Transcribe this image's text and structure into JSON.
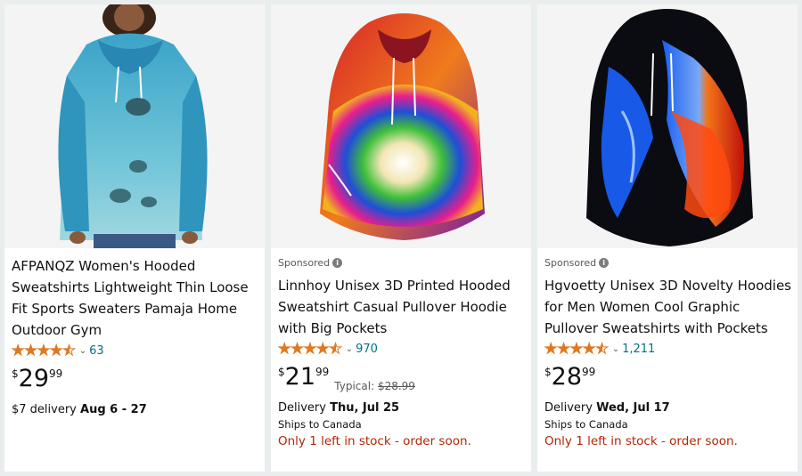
{
  "products": [
    {
      "sponsored": "",
      "title": "AFPANQZ Women's Hooded Sweatshirts Lightweight Thin Loose Fit Sports Sweaters Pamaja Home Outdoor Gym",
      "rating": 4.5,
      "review_count": "63",
      "price_symbol": "$",
      "price_whole": "29",
      "price_fraction": "99",
      "typical_label": "",
      "typical_price": "",
      "delivery_prefix": "$7 delivery ",
      "delivery_date": "Aug 6 - 27",
      "ships_to": "",
      "stock": "",
      "image_icon": "turtle-hoodie-image"
    },
    {
      "sponsored": "Sponsored",
      "title": "Linnhoy Unisex 3D Printed Hooded Sweatshirt Casual Pullover Hoodie with Big Pockets",
      "rating": 4.5,
      "review_count": "970",
      "price_symbol": "$",
      "price_whole": "21",
      "price_fraction": "99",
      "typical_label": "Typical: ",
      "typical_price": "$28.99",
      "delivery_prefix": "Delivery ",
      "delivery_date": "Thu, Jul 25",
      "ships_to": "Ships to Canada",
      "stock": "Only 1 left in stock - order soon.",
      "image_icon": "rainbow-hoodie-image"
    },
    {
      "sponsored": "Sponsored",
      "title": "Hgvoetty Unisex 3D Novelty Hoodies for Men Women Cool Graphic Pullover Sweatshirts with Pockets",
      "rating": 4.5,
      "review_count": "1,211",
      "price_symbol": "$",
      "price_whole": "28",
      "price_fraction": "99",
      "typical_label": "",
      "typical_price": "",
      "delivery_prefix": "Delivery ",
      "delivery_date": "Wed, Jul 17",
      "ships_to": "Ships to Canada",
      "stock": "Only 1 left in stock - order soon.",
      "image_icon": "fire-ice-hoodie-image"
    }
  ],
  "colors": {
    "star": "#de7921",
    "link": "#007185",
    "stock_warning": "#b12704",
    "background": "#eaeded"
  }
}
